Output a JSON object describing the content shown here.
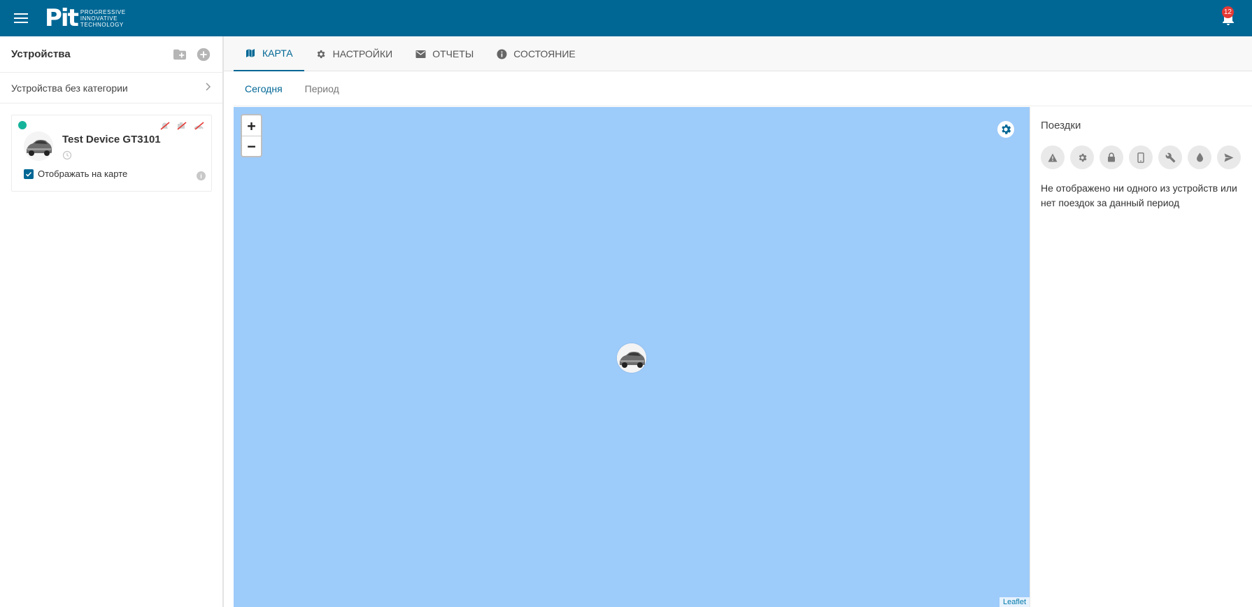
{
  "header": {
    "logo_mark": "Pit",
    "logo_lines": [
      "PROGRESSIVE",
      "INNOVATIVE",
      "TECHNOLOGY"
    ],
    "notification_count": "12"
  },
  "sidebar": {
    "title": "Устройства",
    "category_label": "Устройства без категории",
    "device": {
      "name": "Test Device GT3101",
      "show_on_map_label": "Отображать на карте",
      "show_on_map_checked": true,
      "status_color": "#16b39b"
    }
  },
  "tabs": [
    {
      "label": "КАРТА",
      "icon": "map-icon",
      "active": true
    },
    {
      "label": "НАСТРОЙКИ",
      "icon": "gear-icon",
      "active": false
    },
    {
      "label": "ОТЧЕТЫ",
      "icon": "mail-icon",
      "active": false
    },
    {
      "label": "СОСТОЯНИЕ",
      "icon": "info-icon",
      "active": false
    }
  ],
  "subtabs": [
    {
      "label": "Сегодня",
      "active": true
    },
    {
      "label": "Период",
      "active": false
    }
  ],
  "map": {
    "zoom_in": "+",
    "zoom_out": "−",
    "attribution": "Leaflet",
    "water_color": "#9dcbfa"
  },
  "trips": {
    "title": "Поездки",
    "filters": [
      "warning-icon",
      "gear-icon",
      "lock-icon",
      "phone-icon",
      "wrench-icon",
      "drop-icon",
      "send-icon"
    ],
    "empty_message": "Не отображено ни одного из устройств или нет поездок за данный период"
  },
  "colors": {
    "brand": "#006795",
    "badge": "#e53935"
  }
}
